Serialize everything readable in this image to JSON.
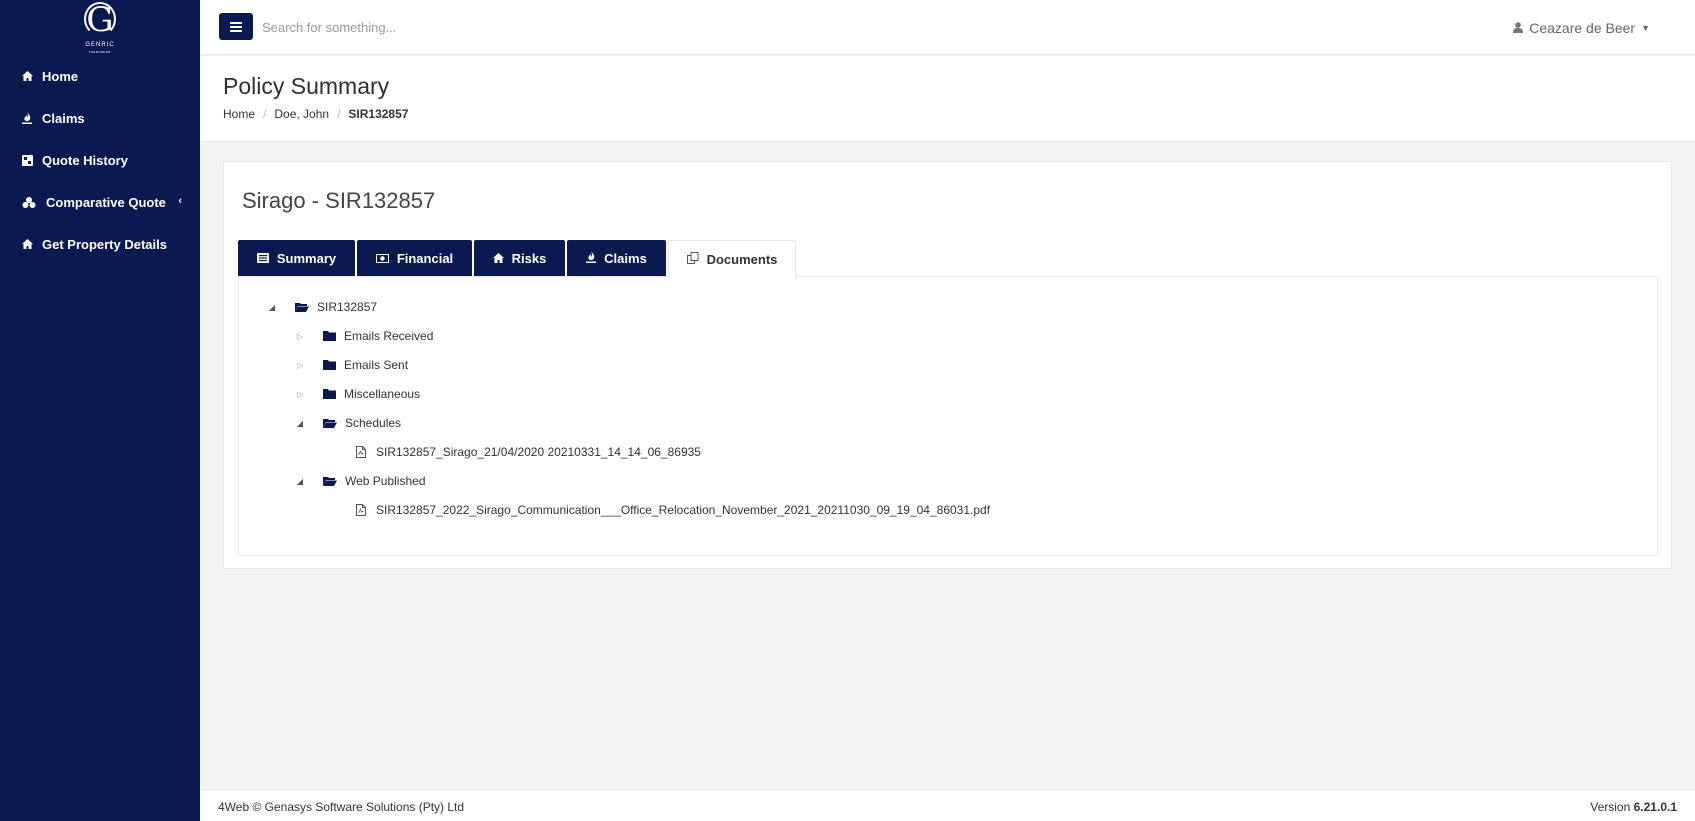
{
  "brand": {
    "logo_letter": "G",
    "logo_line1": "GENRIC",
    "logo_line2": "Insurance"
  },
  "sidebar": {
    "items": [
      {
        "label": "Home",
        "icon": "home-icon"
      },
      {
        "label": "Claims",
        "icon": "fire-icon"
      },
      {
        "label": "Quote History",
        "icon": "history-icon"
      },
      {
        "label": "Comparative Quote",
        "icon": "cubes-icon"
      },
      {
        "label": "Get Property Details",
        "icon": "home-icon"
      }
    ]
  },
  "topbar": {
    "search_placeholder": "Search for something...",
    "user_name": "Ceazare de Beer"
  },
  "page": {
    "title": "Policy Summary",
    "breadcrumb": [
      "Home",
      "Doe, John",
      "SIR132857"
    ]
  },
  "card": {
    "title": "Sirago - SIR132857",
    "tabs": [
      {
        "label": "Summary",
        "icon": "list-icon"
      },
      {
        "label": "Financial",
        "icon": "money-icon"
      },
      {
        "label": "Risks",
        "icon": "home-icon"
      },
      {
        "label": "Claims",
        "icon": "fire-icon"
      },
      {
        "label": "Documents",
        "icon": "copy-icon",
        "active": true
      }
    ]
  },
  "tree": {
    "root": "SIR132857",
    "folders": [
      {
        "label": "Emails Received",
        "expanded": false
      },
      {
        "label": "Emails Sent",
        "expanded": false
      },
      {
        "label": "Miscellaneous",
        "expanded": false
      },
      {
        "label": "Schedules",
        "expanded": true,
        "files": [
          "SIR132857_Sirago_21/04/2020 20210331_14_14_06_86935"
        ]
      },
      {
        "label": "Web Published",
        "expanded": true,
        "files": [
          "SIR132857_2022_Sirago_Communication___Office_Relocation_November_2021_20211030_09_19_04_86031.pdf"
        ]
      }
    ]
  },
  "footer": {
    "copyright": "4Web © Genasys Software Solutions (Pty) Ltd",
    "version_label": "Version",
    "version": "6.21.0.1"
  },
  "colors": {
    "primary": "#0b1951",
    "background": "#f3f3f4"
  }
}
